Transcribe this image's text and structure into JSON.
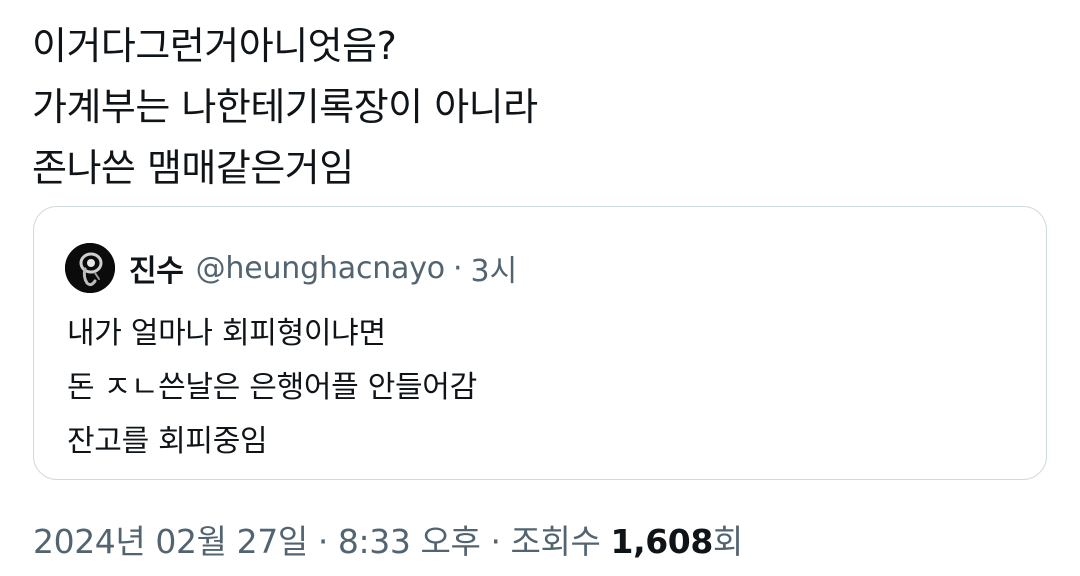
{
  "tweet": {
    "lines": [
      "이거다그런거아니엇음?",
      "가계부는 나한테기록장이 아니라",
      "존나쓴 맴매같은거임"
    ]
  },
  "quoted_tweet": {
    "avatar_icon": "dark-creature-avatar-icon",
    "author_name": "진수",
    "author_handle": "@heunghacnayo",
    "separator": "·",
    "time": "3시",
    "lines": [
      "내가 얼마나 회피형이냐면",
      "돈 ㅈㄴ쓴날은 은행어플 안들어감",
      "잔고를 회피중임"
    ]
  },
  "meta": {
    "date": "2024년 02월 27일",
    "separator": "·",
    "time": "8:33 오후",
    "views_label": "조회수",
    "views_count": "1,608",
    "views_suffix": "회"
  },
  "colors": {
    "text_primary": "#0f1419",
    "text_secondary": "#536471",
    "border": "#cfd9de"
  }
}
